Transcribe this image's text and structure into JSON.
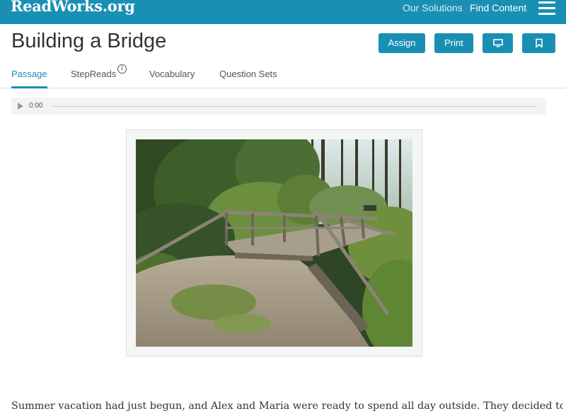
{
  "header": {
    "logo": "ReadWorks",
    "logo_suffix": ".org",
    "nav": [
      "Our Solutions",
      "Find Content"
    ],
    "menu_icon": "hamburger-icon"
  },
  "page": {
    "title": "Building a Bridge",
    "actions": {
      "assign": "Assign",
      "print": "Print",
      "present_icon": "monitor-icon",
      "bookmark_icon": "bookmark-icon"
    }
  },
  "tabs": [
    {
      "label": "Passage",
      "active": true
    },
    {
      "label": "StepReads",
      "info_icon": "i"
    },
    {
      "label": "Vocabulary"
    },
    {
      "label": "Question Sets"
    }
  ],
  "audio": {
    "time": "0:00",
    "play_icon": "play-icon"
  },
  "passage": {
    "first_line": "Summer vacation had just begun, and Alex and Maria were ready to spend all day outside. They decided to walk to"
  },
  "colors": {
    "brand": "#1a8fb4",
    "text": "#333333"
  }
}
